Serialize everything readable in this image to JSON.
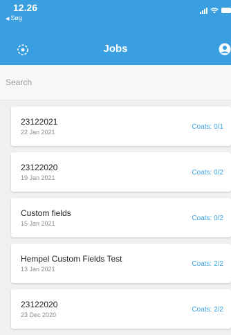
{
  "status_bar": {
    "time": "12.26",
    "back_label": "Søg",
    "back_icon": "small-left-triangle"
  },
  "header": {
    "title": "Jobs",
    "left_icon": "target-icon",
    "right_icon": "profile-icon",
    "background_color": "#3a9fe0"
  },
  "search": {
    "placeholder": "Search",
    "value": ""
  },
  "jobs": [
    {
      "name": "23122021",
      "date": "22 Jan 2021",
      "coats": "Coats: 0/1"
    },
    {
      "name": "23122020",
      "date": "19 Jan 2021",
      "coats": "Coats: 0/2"
    },
    {
      "name": "Custom fields",
      "date": "15 Jan 2021",
      "coats": "Coats: 0/2"
    },
    {
      "name": "Hempel Custom Fields Test",
      "date": "13 Jan 2021",
      "coats": "Coats: 2/2"
    },
    {
      "name": "23122020",
      "date": "23 Dec 2020",
      "coats": "Coats: 2/2"
    }
  ],
  "colors": {
    "accent": "#3a9fe0",
    "list_background": "#f0f0f0"
  }
}
